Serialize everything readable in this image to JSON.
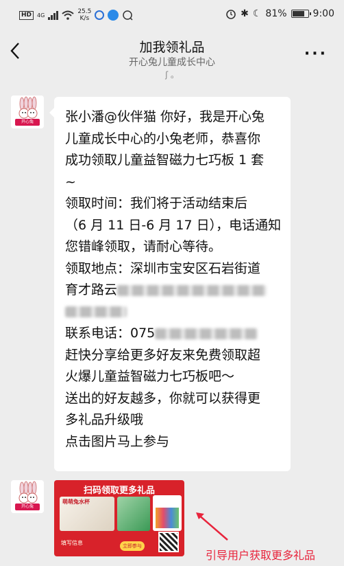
{
  "status_bar": {
    "network_type": "4G",
    "speed_value": "25.5",
    "speed_unit": "K/s",
    "battery": "81%",
    "battery_level": 0.81,
    "time": "9:00"
  },
  "header": {
    "back_icon": "chevron-left-icon",
    "title": "加我领礼品",
    "subtitle": "开心兔儿童成长中心",
    "sub_status": "ʃ 。",
    "more_icon": "more-icon"
  },
  "avatar_label": "开心兔",
  "message": {
    "lines": [
      "张小潘@伙伴猫 你好，我是开心兔",
      "儿童成长中心的小兔老师，恭喜你",
      "成功领取儿童益智磁力七巧板 1 套",
      "~",
      "领取时间：我们将于活动结束后",
      "（6 月 11 日-6 月 17 日），电话通知",
      "您错峰领取，请耐心等待。",
      "领取地点：深圳市宝安区石岩街道",
      "育才路云",
      "",
      "联系电话：075",
      "",
      "赶快分享给更多好友来免费领取超",
      "火爆儿童益智磁力七巧板吧～",
      "送出的好友越多，你就可以获得更",
      "多礼品升级哦",
      "点击图片马上参与"
    ]
  },
  "image_card": {
    "banner": "扫码领取更多礼品",
    "product": "萌萌兔水杯",
    "note": "填写信息",
    "button": "立即参与"
  },
  "annotation": "引导用户获取更多礼品",
  "colors": {
    "background": "#ededed",
    "bubble": "#ffffff",
    "card_red": "#d8222a",
    "annotation_red": "#e8243c"
  }
}
